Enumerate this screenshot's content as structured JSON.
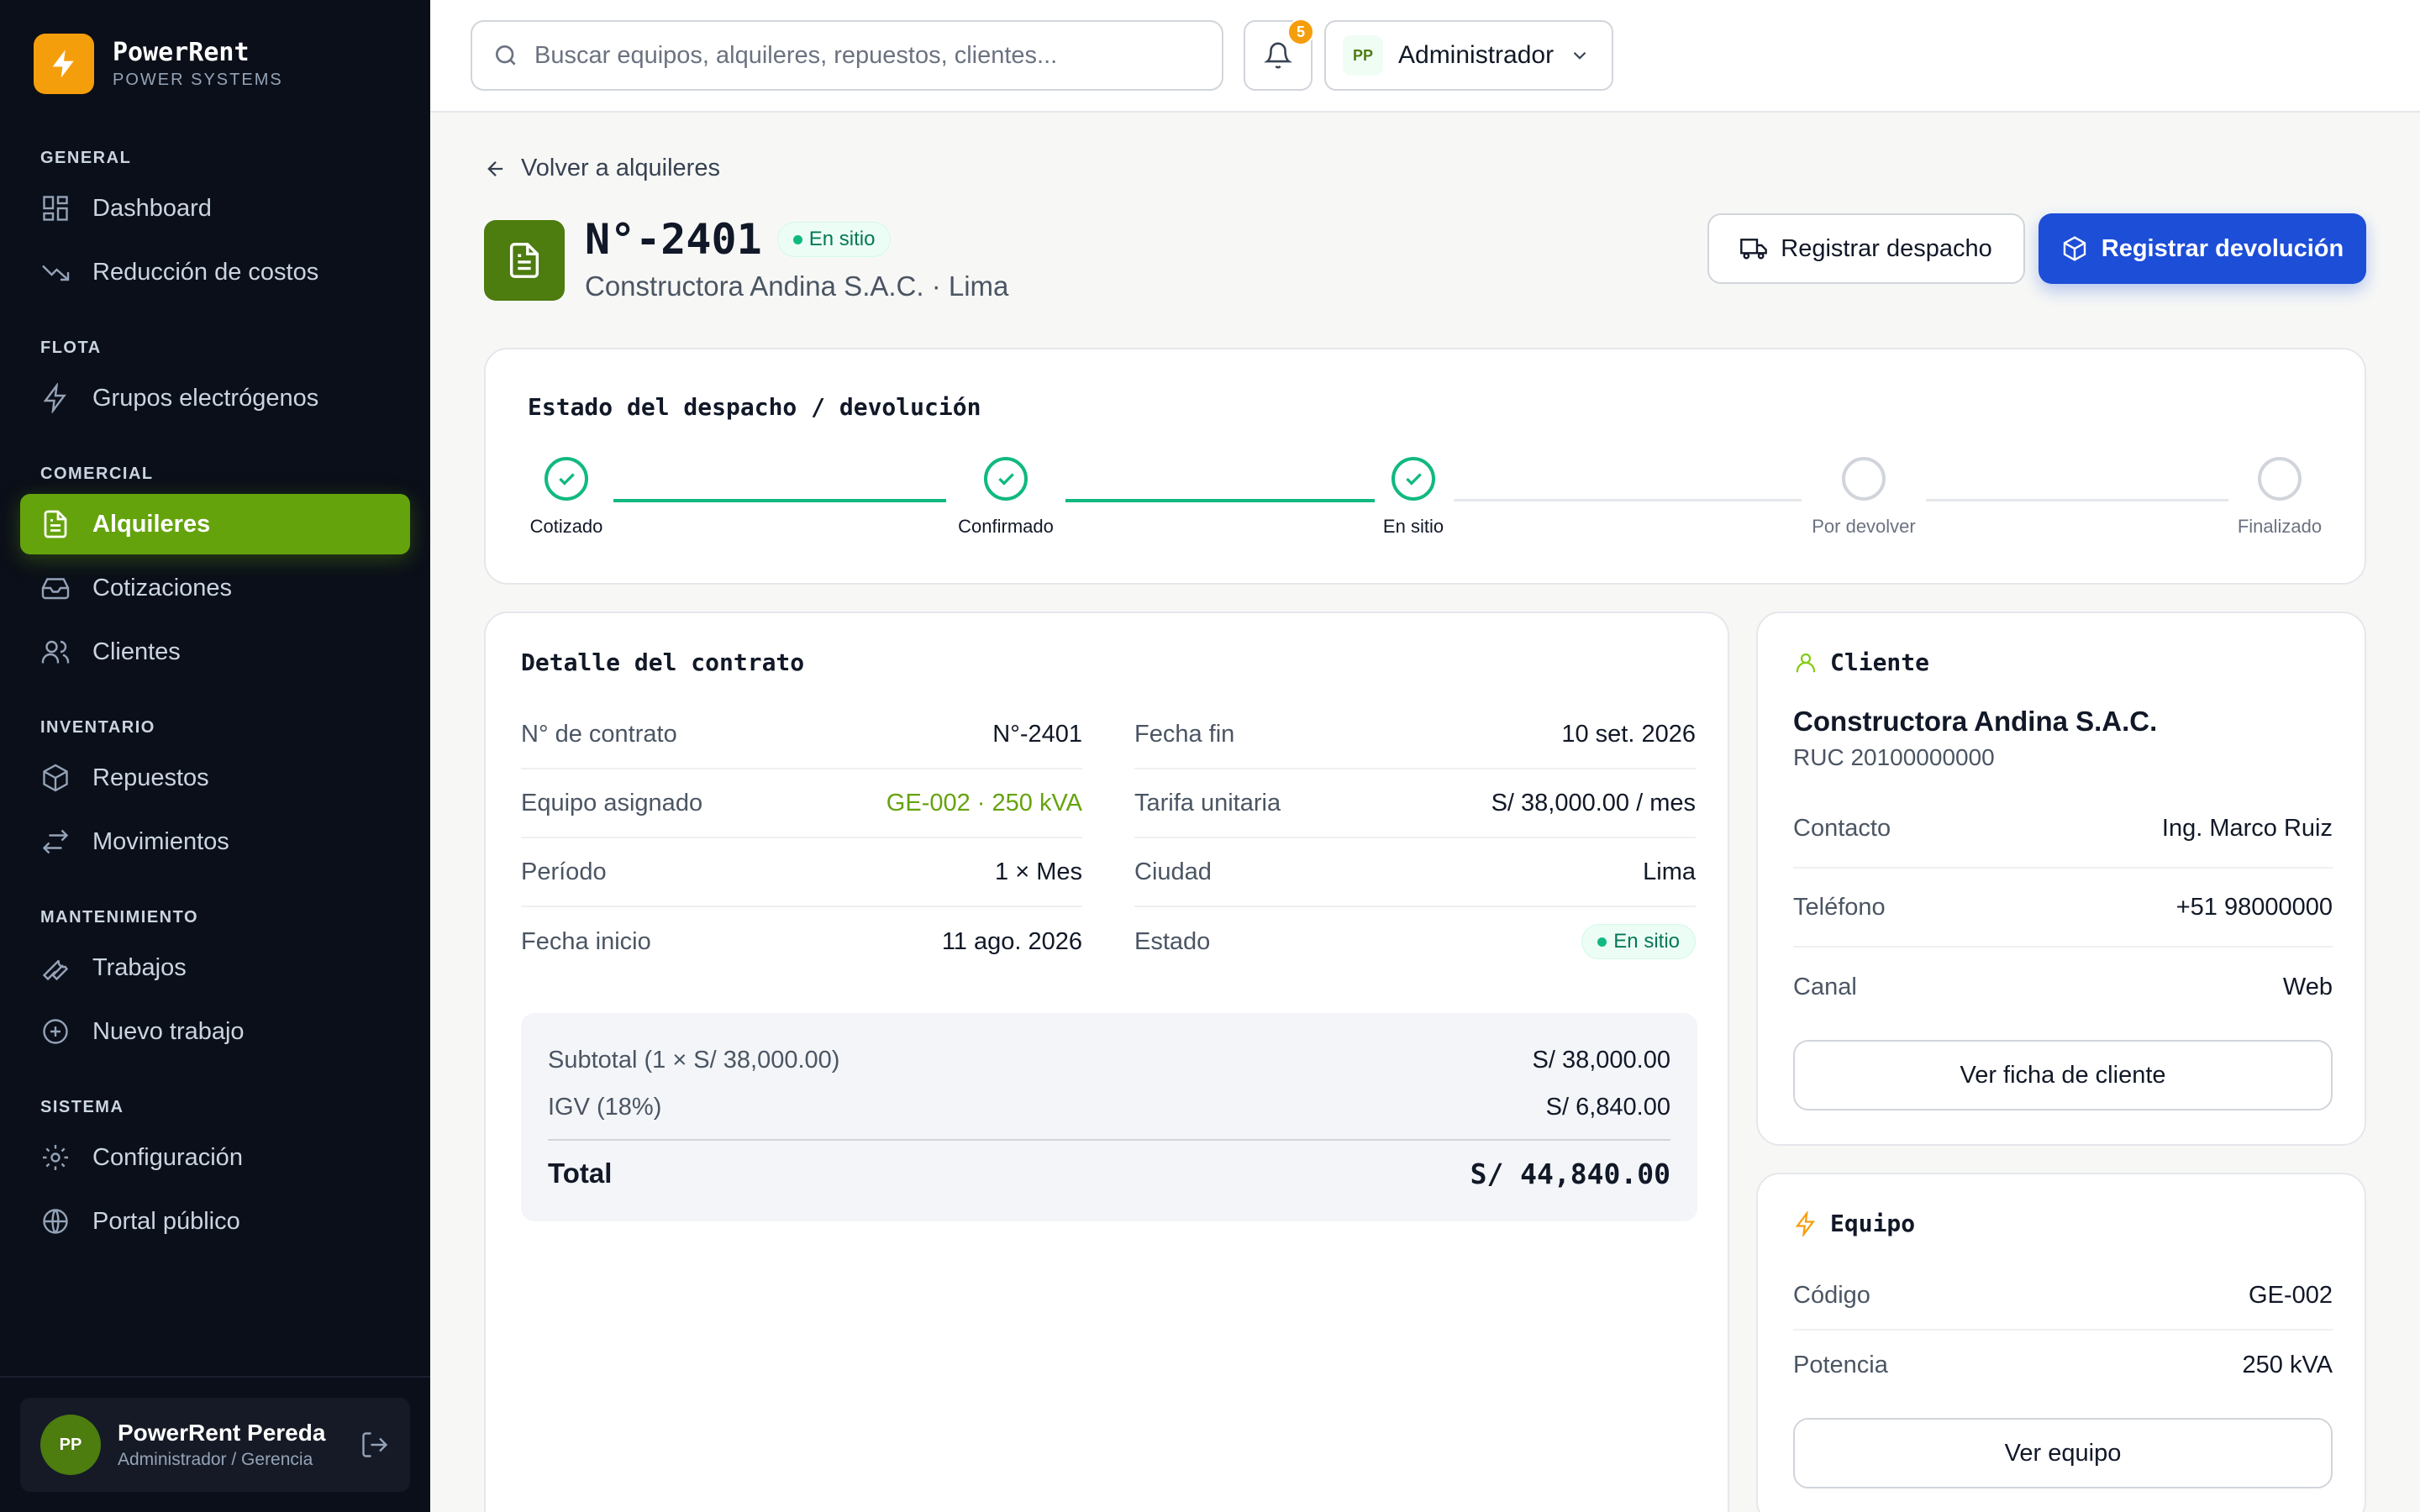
{
  "brand": {
    "name": "PowerRent",
    "subtitle": "POWER SYSTEMS"
  },
  "nav": {
    "sections": {
      "general": "GENERAL",
      "flota": "FLOTA",
      "comercial": "COMERCIAL",
      "inventario": "INVENTARIO",
      "mantenimiento": "MANTENIMIENTO",
      "sistema": "SISTEMA"
    },
    "items": {
      "dashboard": "Dashboard",
      "reduccion": "Reducción de costos",
      "grupos": "Grupos electrógenos",
      "alquileres": "Alquileres",
      "cotizaciones": "Cotizaciones",
      "clientes": "Clientes",
      "repuestos": "Repuestos",
      "movimientos": "Movimientos",
      "trabajos": "Trabajos",
      "nuevo_trabajo": "Nuevo trabajo",
      "configuracion": "Configuración",
      "portal": "Portal público"
    }
  },
  "user": {
    "initials": "PP",
    "name": "PowerRent Pereda",
    "role": "Administrador / Gerencia"
  },
  "topbar": {
    "search_placeholder": "Buscar equipos, alquileres, repuestos, clientes...",
    "notifications_count": "5",
    "role_initials": "PP",
    "role_label": "Administrador"
  },
  "page": {
    "back_label": "Volver a alquileres",
    "title": "N°-2401",
    "status": "En sitio",
    "subtitle": "Constructora Andina S.A.C. · Lima",
    "btn_dispatch": "Registrar despacho",
    "btn_return": "Registrar devolución"
  },
  "stepper": {
    "title": "Estado del despacho / devolución",
    "steps": [
      {
        "label": "Cotizado",
        "done": true
      },
      {
        "label": "Confirmado",
        "done": true
      },
      {
        "label": "En sitio",
        "done": true
      },
      {
        "label": "Por devolver",
        "done": false
      },
      {
        "label": "Finalizado",
        "done": false
      }
    ]
  },
  "contract": {
    "title": "Detalle del contrato",
    "left": [
      {
        "k": "N° de contrato",
        "v": "N°-2401"
      },
      {
        "k": "Equipo asignado",
        "v": "GE-002 · 250 kVA"
      },
      {
        "k": "Período",
        "v": "1 × Mes"
      },
      {
        "k": "Fecha inicio",
        "v": "11 ago. 2026"
      }
    ],
    "right": [
      {
        "k": "Fecha fin",
        "v": "10 set. 2026"
      },
      {
        "k": "Tarifa unitaria",
        "v": "S/ 38,000.00 / mes"
      },
      {
        "k": "Ciudad",
        "v": "Lima"
      },
      {
        "k": "Estado",
        "v": "En sitio"
      }
    ],
    "totals": {
      "subtotal_label": "Subtotal (1 × S/ 38,000.00)",
      "subtotal_value": "S/ 38,000.00",
      "igv_label": "IGV (18%)",
      "igv_value": "S/ 6,840.00",
      "total_label": "Total",
      "total_value": "S/ 44,840.00"
    }
  },
  "client": {
    "title": "Cliente",
    "name": "Constructora Andina S.A.C.",
    "ruc": "RUC 20100000000",
    "rows": [
      {
        "k": "Contacto",
        "v": "Ing. Marco Ruiz"
      },
      {
        "k": "Teléfono",
        "v": "+51 98000000"
      },
      {
        "k": "Canal",
        "v": "Web"
      }
    ],
    "button": "Ver ficha de cliente"
  },
  "equipment": {
    "title": "Equipo",
    "rows": [
      {
        "k": "Código",
        "v": "GE-002"
      },
      {
        "k": "Potencia",
        "v": "250 kVA"
      }
    ],
    "button": "Ver equipo"
  },
  "colors": {
    "accent_green": "#65a30d",
    "primary_blue": "#1d4ed8",
    "brand_orange": "#f59e0b",
    "success": "#10b981",
    "sidebar_bg": "#0b0f19"
  }
}
